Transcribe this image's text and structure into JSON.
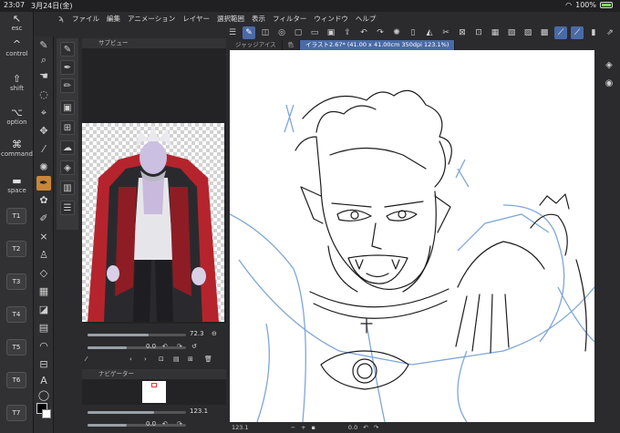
{
  "status_bar": {
    "time": "23:07",
    "date": "3月24日(金)",
    "battery": "100%"
  },
  "shortcut_panel": {
    "esc": "esc",
    "control": "control",
    "shift": "shift",
    "option": "option",
    "command": "command",
    "space": "space",
    "t_keys": [
      "T1",
      "T2",
      "T3",
      "T4",
      "T5",
      "T6",
      "T7"
    ]
  },
  "menu": {
    "items": [
      "ファイル",
      "編集",
      "アニメーション",
      "レイヤー",
      "選択範囲",
      "表示",
      "フィルター",
      "ウィンドウ",
      "ヘルプ"
    ]
  },
  "subview": {
    "title": "サブビュー",
    "zoom": "72.3",
    "rotation": "0.0"
  },
  "navigator": {
    "title": "ナビゲーター",
    "zoom": "123.1",
    "rotation": "0.0"
  },
  "canvas_tabs": [
    {
      "label": "ジャッジアイス"
    },
    {
      "label": "色"
    },
    {
      "label": "イラスト2.67* (41.00 x 41.00cm 350dpi 123.1%)"
    }
  ],
  "canvas_footer": {
    "zoom": "123.1",
    "value2": "0.0"
  },
  "colors": {
    "accent": "#4a6aa6",
    "active_tool": "#c8863a",
    "line_blue": "#7ea6d8"
  }
}
